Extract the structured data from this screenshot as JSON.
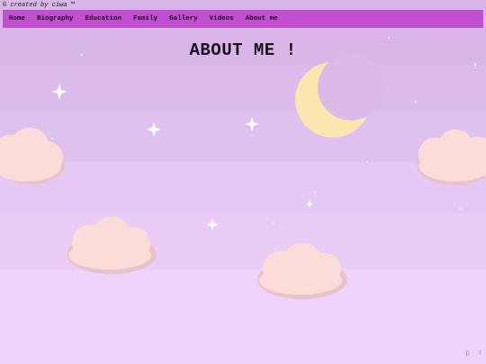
{
  "header": {
    "credit_symbol": "©",
    "credit_text": "created by ciwa",
    "credit_tm": "™"
  },
  "nav": {
    "items": [
      {
        "label": "Home"
      },
      {
        "label": "Biography"
      },
      {
        "label": "Education"
      },
      {
        "label": "Family"
      },
      {
        "label": "Gallery"
      },
      {
        "label": "Videos"
      },
      {
        "label": "About me"
      }
    ]
  },
  "main": {
    "title": "ABOUT ME !"
  },
  "corner_text": "p l",
  "colors": {
    "nav_bg": "#c24fd0",
    "moon": "#fbe6b0",
    "cloud": "#fbdcd8",
    "cloud_shadow": "#ebc2c8",
    "sky_top": "#d8b7e8",
    "sky_bottom": "#efd3fb"
  }
}
